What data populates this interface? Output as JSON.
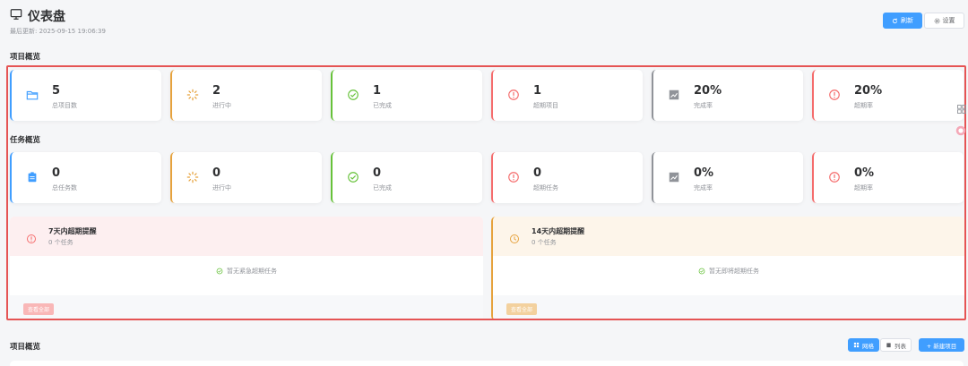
{
  "header": {
    "title": "仪表盘",
    "updated": "最后更新: 2025-09-15 19:06:39",
    "refresh_label": "刷新",
    "settings_label": "设置"
  },
  "projects_section": {
    "title": "项目概览",
    "cards": [
      {
        "value": "5",
        "label": "总项目数",
        "icon": "folder-icon",
        "color": "#409eff"
      },
      {
        "value": "2",
        "label": "进行中",
        "icon": "loading-icon",
        "color": "#e6a23c"
      },
      {
        "value": "1",
        "label": "已完成",
        "icon": "check-circle-icon",
        "color": "#67c23a"
      },
      {
        "value": "1",
        "label": "超期项目",
        "icon": "warning-circle-icon",
        "color": "#f56c6c"
      },
      {
        "value": "20%",
        "label": "完成率",
        "icon": "trend-chart-icon",
        "color": "#909399"
      },
      {
        "value": "20%",
        "label": "超期率",
        "icon": "warning-circle-icon",
        "color": "#f56c6c"
      }
    ]
  },
  "tasks_section": {
    "title": "任务概览",
    "cards": [
      {
        "value": "0",
        "label": "总任务数",
        "icon": "clipboard-icon",
        "color": "#409eff"
      },
      {
        "value": "0",
        "label": "进行中",
        "icon": "loading-icon",
        "color": "#e6a23c"
      },
      {
        "value": "0",
        "label": "已完成",
        "icon": "check-circle-icon",
        "color": "#67c23a"
      },
      {
        "value": "0",
        "label": "超期任务",
        "icon": "warning-circle-icon",
        "color": "#f56c6c"
      },
      {
        "value": "0%",
        "label": "完成率",
        "icon": "trend-chart-icon",
        "color": "#909399"
      },
      {
        "value": "0%",
        "label": "超期率",
        "icon": "warning-circle-icon",
        "color": "#f56c6c"
      }
    ]
  },
  "alerts": [
    {
      "title": "7天内超期提醒",
      "count": "0 个任务",
      "empty": "暂无紧急超期任务",
      "view_all": "查看全部",
      "icon": "warning-circle-icon",
      "color": "#f56c6c"
    },
    {
      "title": "14天内超期提醒",
      "count": "0 个任务",
      "empty": "暂无即将超期任务",
      "view_all": "查看全部",
      "icon": "clock-icon",
      "color": "#e6a23c"
    }
  ],
  "bottom": {
    "title": "项目概览",
    "grid_label": "网格",
    "list_label": "列表",
    "new_label": "+ 新建项目"
  },
  "colors": {
    "accent": "#409eff",
    "highlight": "#e55454"
  }
}
